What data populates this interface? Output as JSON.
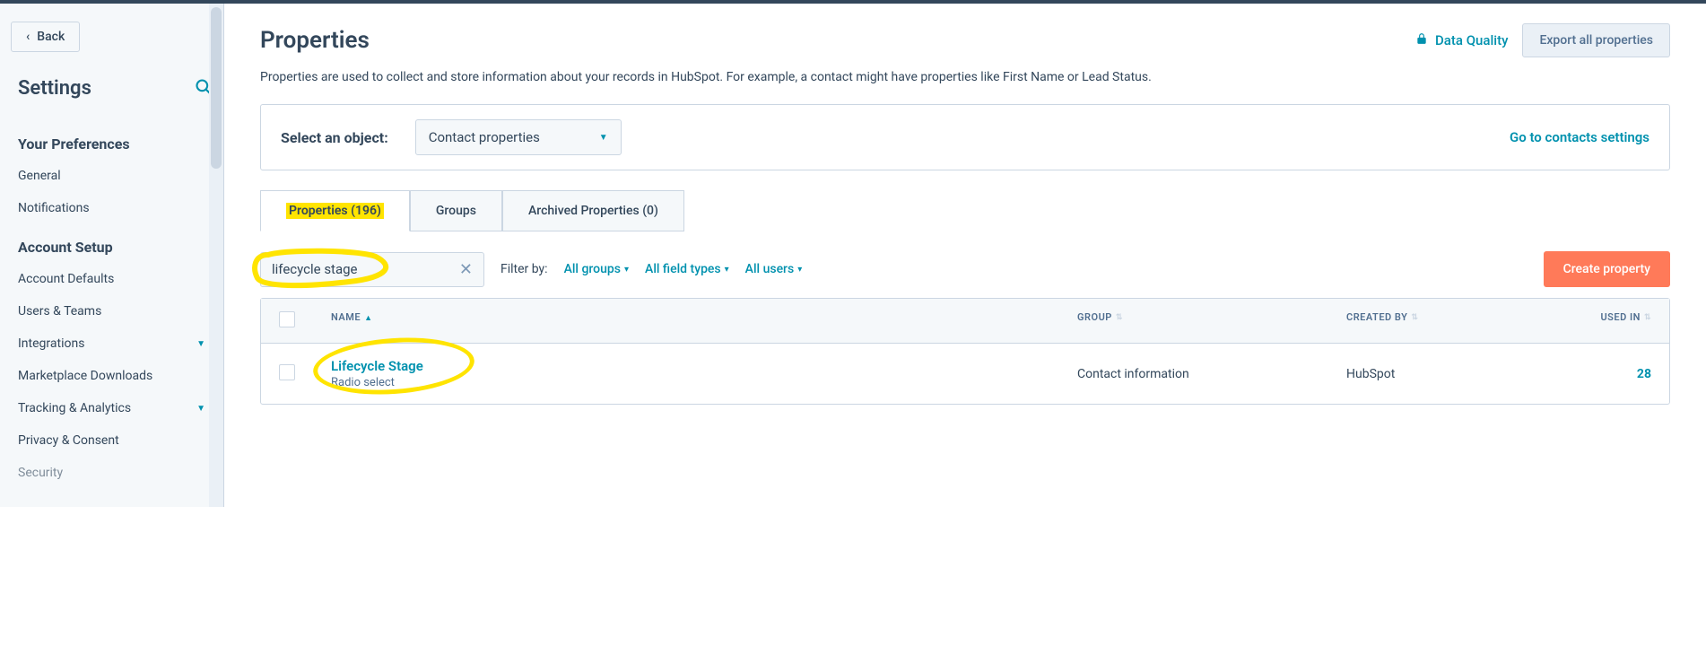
{
  "sidebar": {
    "back_label": "Back",
    "settings_title": "Settings",
    "sections": [
      {
        "title": "Your Preferences",
        "items": [
          "General",
          "Notifications"
        ]
      },
      {
        "title": "Account Setup",
        "items": [
          "Account Defaults",
          "Users & Teams",
          "Integrations",
          "Marketplace Downloads",
          "Tracking & Analytics",
          "Privacy & Consent",
          "Security"
        ]
      }
    ]
  },
  "page": {
    "title": "Properties",
    "description": "Properties are used to collect and store information about your records in HubSpot. For example, a contact might have properties like First Name or Lead Status.",
    "data_quality_label": "Data Quality",
    "export_label": "Export all properties"
  },
  "object_select": {
    "label": "Select an object:",
    "selected": "Contact properties",
    "settings_link": "Go to contacts settings"
  },
  "tabs": {
    "properties": "Properties (196)",
    "groups": "Groups",
    "archived": "Archived Properties (0)"
  },
  "filters": {
    "search_value": "lifecycle stage",
    "filter_by_label": "Filter by:",
    "all_groups": "All groups",
    "all_field_types": "All field types",
    "all_users": "All users",
    "create_label": "Create property"
  },
  "table": {
    "headers": {
      "name": "NAME",
      "group": "GROUP",
      "created_by": "CREATED BY",
      "used_in": "USED IN"
    },
    "rows": [
      {
        "name": "Lifecycle Stage",
        "subtype": "Radio select",
        "group": "Contact information",
        "created_by": "HubSpot",
        "used_in": "28"
      }
    ]
  }
}
